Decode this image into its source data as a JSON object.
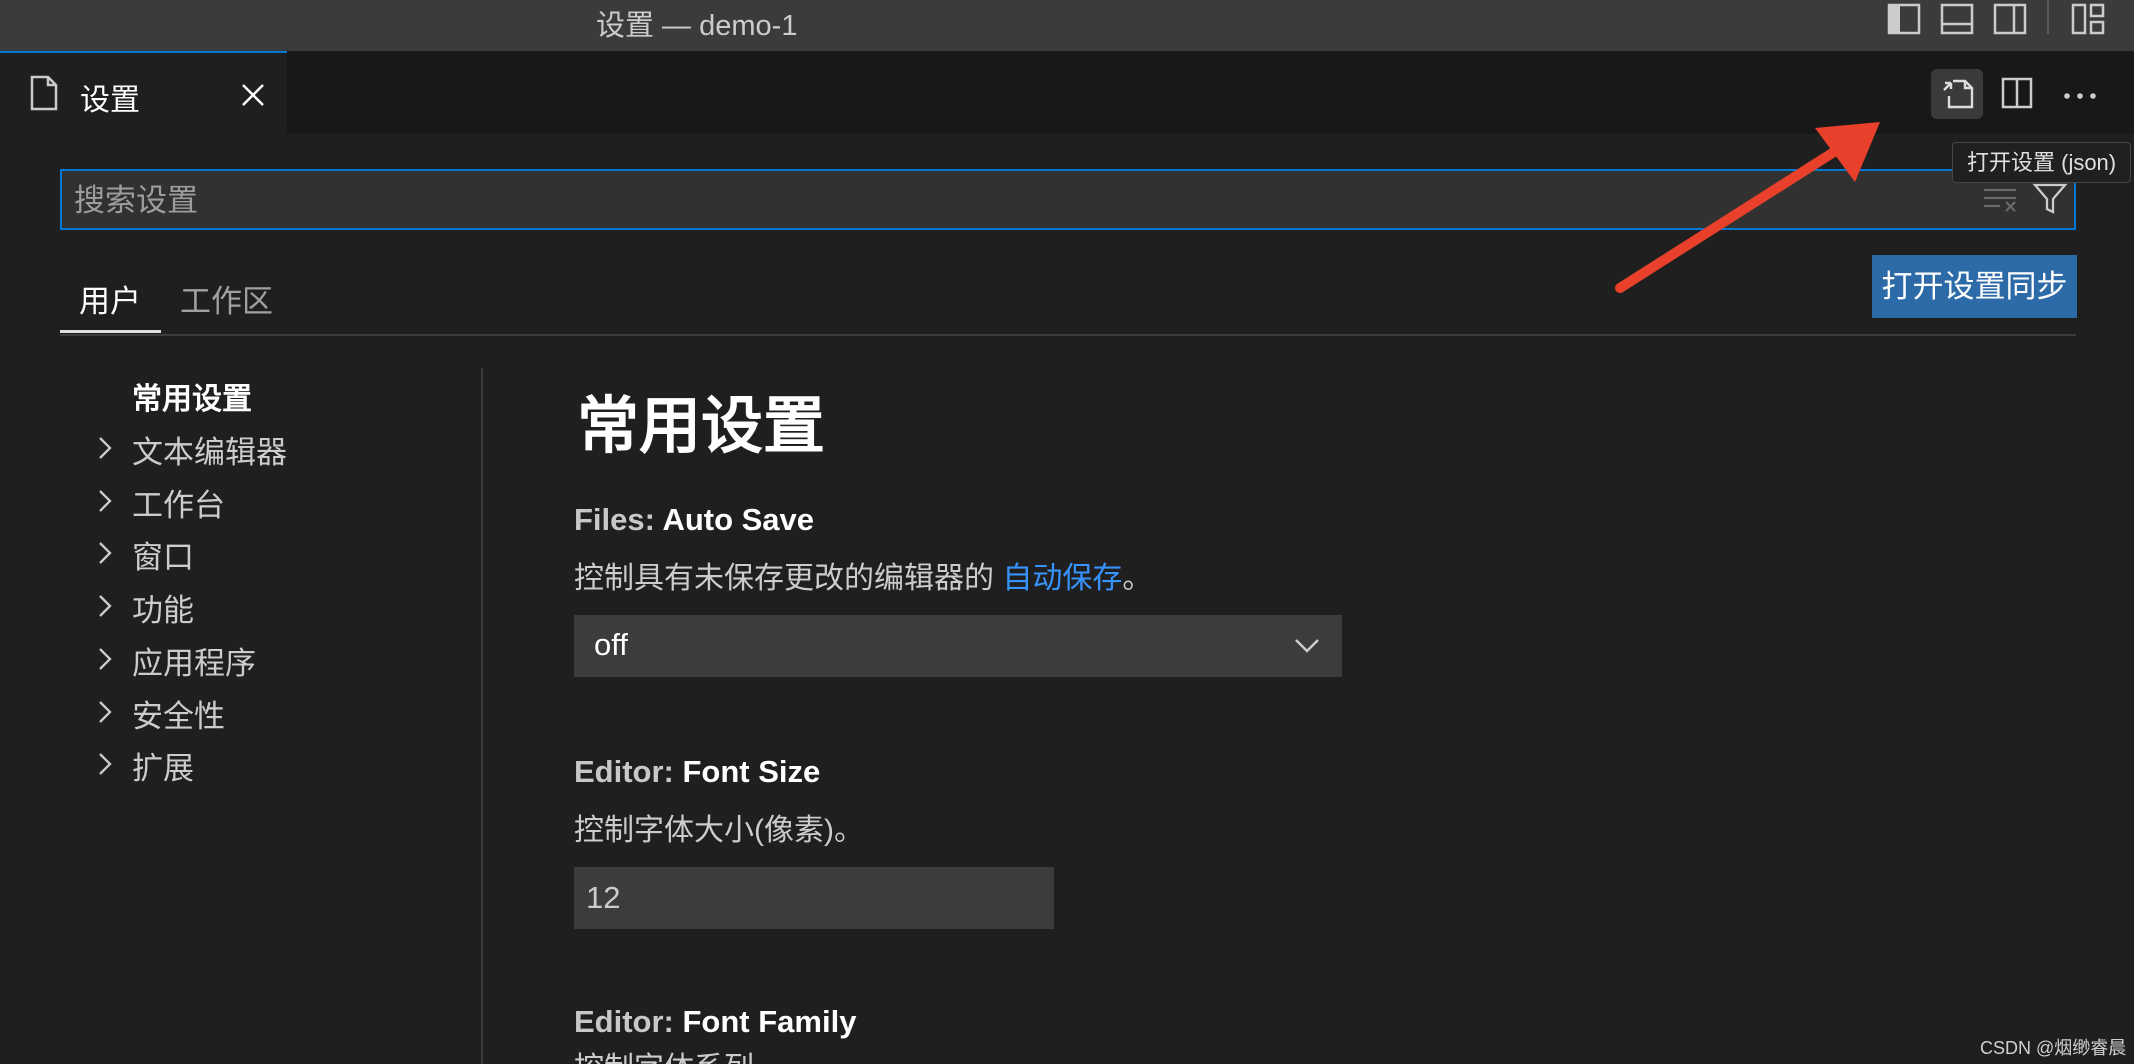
{
  "window": {
    "title": "设置 — demo-1"
  },
  "tab": {
    "label": "设置"
  },
  "tooltip": {
    "text": "打开设置 (json)"
  },
  "search": {
    "placeholder": "搜索设置",
    "value": ""
  },
  "scope_tabs": [
    {
      "label": "用户",
      "active": true
    },
    {
      "label": "工作区",
      "active": false
    }
  ],
  "sync_button": {
    "label": "打开设置同步"
  },
  "toc": {
    "items": [
      {
        "label": "常用设置",
        "expandable": false
      },
      {
        "label": "文本编辑器",
        "expandable": true
      },
      {
        "label": "工作台",
        "expandable": true
      },
      {
        "label": "窗口",
        "expandable": true
      },
      {
        "label": "功能",
        "expandable": true
      },
      {
        "label": "应用程序",
        "expandable": true
      },
      {
        "label": "安全性",
        "expandable": true
      },
      {
        "label": "扩展",
        "expandable": true
      }
    ]
  },
  "content": {
    "section_title": "常用设置",
    "settings": [
      {
        "category": "Files: ",
        "name": "Auto Save",
        "description_prefix": "控制具有未保存更改的编辑器的 ",
        "description_link": "自动保存",
        "description_suffix": "。",
        "value": "off"
      },
      {
        "category": "Editor: ",
        "name": "Font Size",
        "description": "控制字体大小(像素)。",
        "value": "12"
      },
      {
        "category": "Editor: ",
        "name": "Font Family",
        "description": "控制字体系列。"
      }
    ]
  },
  "watermark": "CSDN @烟缈睿晨",
  "colors": {
    "accent": "#0078d4",
    "sync_button": "#2d6aa8",
    "link": "#3794ff",
    "annotation_arrow": "#e8402a"
  },
  "icons": {
    "title_bar": [
      "toggle-primary-sidebar-icon",
      "toggle-panel-icon",
      "toggle-secondary-sidebar-icon",
      "customize-layout-icon"
    ],
    "editor_actions": [
      "open-settings-json-icon",
      "split-editor-icon",
      "more-actions-icon"
    ]
  }
}
